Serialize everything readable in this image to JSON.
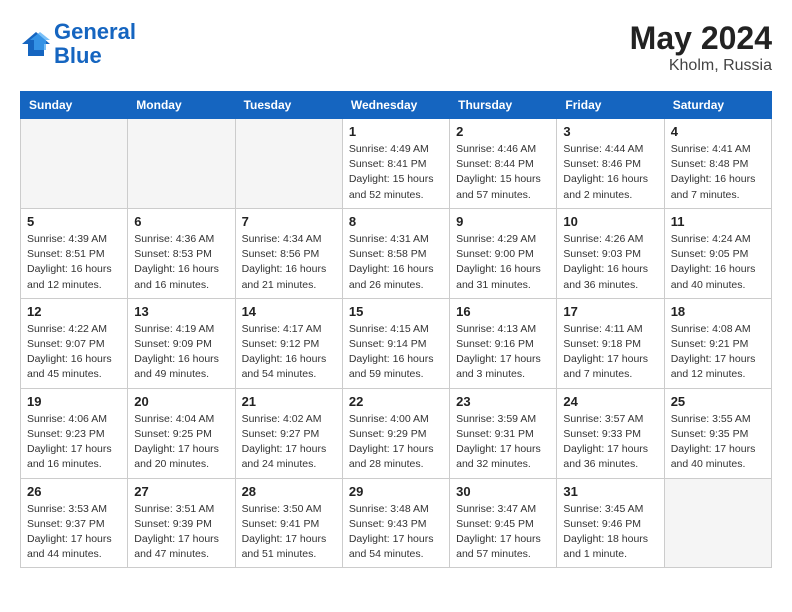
{
  "header": {
    "logo_line1": "General",
    "logo_line2": "Blue",
    "month_year": "May 2024",
    "location": "Kholm, Russia"
  },
  "weekdays": [
    "Sunday",
    "Monday",
    "Tuesday",
    "Wednesday",
    "Thursday",
    "Friday",
    "Saturday"
  ],
  "weeks": [
    [
      {
        "day": "",
        "info": ""
      },
      {
        "day": "",
        "info": ""
      },
      {
        "day": "",
        "info": ""
      },
      {
        "day": "1",
        "info": "Sunrise: 4:49 AM\nSunset: 8:41 PM\nDaylight: 15 hours and 52 minutes."
      },
      {
        "day": "2",
        "info": "Sunrise: 4:46 AM\nSunset: 8:44 PM\nDaylight: 15 hours and 57 minutes."
      },
      {
        "day": "3",
        "info": "Sunrise: 4:44 AM\nSunset: 8:46 PM\nDaylight: 16 hours and 2 minutes."
      },
      {
        "day": "4",
        "info": "Sunrise: 4:41 AM\nSunset: 8:48 PM\nDaylight: 16 hours and 7 minutes."
      }
    ],
    [
      {
        "day": "5",
        "info": "Sunrise: 4:39 AM\nSunset: 8:51 PM\nDaylight: 16 hours and 12 minutes."
      },
      {
        "day": "6",
        "info": "Sunrise: 4:36 AM\nSunset: 8:53 PM\nDaylight: 16 hours and 16 minutes."
      },
      {
        "day": "7",
        "info": "Sunrise: 4:34 AM\nSunset: 8:56 PM\nDaylight: 16 hours and 21 minutes."
      },
      {
        "day": "8",
        "info": "Sunrise: 4:31 AM\nSunset: 8:58 PM\nDaylight: 16 hours and 26 minutes."
      },
      {
        "day": "9",
        "info": "Sunrise: 4:29 AM\nSunset: 9:00 PM\nDaylight: 16 hours and 31 minutes."
      },
      {
        "day": "10",
        "info": "Sunrise: 4:26 AM\nSunset: 9:03 PM\nDaylight: 16 hours and 36 minutes."
      },
      {
        "day": "11",
        "info": "Sunrise: 4:24 AM\nSunset: 9:05 PM\nDaylight: 16 hours and 40 minutes."
      }
    ],
    [
      {
        "day": "12",
        "info": "Sunrise: 4:22 AM\nSunset: 9:07 PM\nDaylight: 16 hours and 45 minutes."
      },
      {
        "day": "13",
        "info": "Sunrise: 4:19 AM\nSunset: 9:09 PM\nDaylight: 16 hours and 49 minutes."
      },
      {
        "day": "14",
        "info": "Sunrise: 4:17 AM\nSunset: 9:12 PM\nDaylight: 16 hours and 54 minutes."
      },
      {
        "day": "15",
        "info": "Sunrise: 4:15 AM\nSunset: 9:14 PM\nDaylight: 16 hours and 59 minutes."
      },
      {
        "day": "16",
        "info": "Sunrise: 4:13 AM\nSunset: 9:16 PM\nDaylight: 17 hours and 3 minutes."
      },
      {
        "day": "17",
        "info": "Sunrise: 4:11 AM\nSunset: 9:18 PM\nDaylight: 17 hours and 7 minutes."
      },
      {
        "day": "18",
        "info": "Sunrise: 4:08 AM\nSunset: 9:21 PM\nDaylight: 17 hours and 12 minutes."
      }
    ],
    [
      {
        "day": "19",
        "info": "Sunrise: 4:06 AM\nSunset: 9:23 PM\nDaylight: 17 hours and 16 minutes."
      },
      {
        "day": "20",
        "info": "Sunrise: 4:04 AM\nSunset: 9:25 PM\nDaylight: 17 hours and 20 minutes."
      },
      {
        "day": "21",
        "info": "Sunrise: 4:02 AM\nSunset: 9:27 PM\nDaylight: 17 hours and 24 minutes."
      },
      {
        "day": "22",
        "info": "Sunrise: 4:00 AM\nSunset: 9:29 PM\nDaylight: 17 hours and 28 minutes."
      },
      {
        "day": "23",
        "info": "Sunrise: 3:59 AM\nSunset: 9:31 PM\nDaylight: 17 hours and 32 minutes."
      },
      {
        "day": "24",
        "info": "Sunrise: 3:57 AM\nSunset: 9:33 PM\nDaylight: 17 hours and 36 minutes."
      },
      {
        "day": "25",
        "info": "Sunrise: 3:55 AM\nSunset: 9:35 PM\nDaylight: 17 hours and 40 minutes."
      }
    ],
    [
      {
        "day": "26",
        "info": "Sunrise: 3:53 AM\nSunset: 9:37 PM\nDaylight: 17 hours and 44 minutes."
      },
      {
        "day": "27",
        "info": "Sunrise: 3:51 AM\nSunset: 9:39 PM\nDaylight: 17 hours and 47 minutes."
      },
      {
        "day": "28",
        "info": "Sunrise: 3:50 AM\nSunset: 9:41 PM\nDaylight: 17 hours and 51 minutes."
      },
      {
        "day": "29",
        "info": "Sunrise: 3:48 AM\nSunset: 9:43 PM\nDaylight: 17 hours and 54 minutes."
      },
      {
        "day": "30",
        "info": "Sunrise: 3:47 AM\nSunset: 9:45 PM\nDaylight: 17 hours and 57 minutes."
      },
      {
        "day": "31",
        "info": "Sunrise: 3:45 AM\nSunset: 9:46 PM\nDaylight: 18 hours and 1 minute."
      },
      {
        "day": "",
        "info": ""
      }
    ]
  ]
}
